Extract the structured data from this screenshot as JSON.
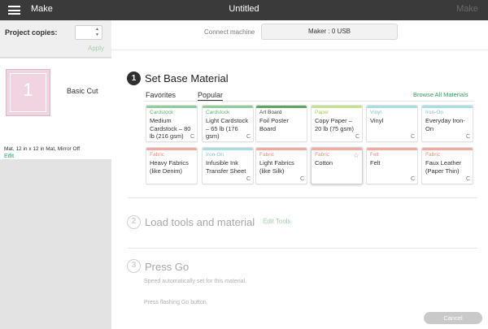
{
  "topbar": {
    "app_name": "Make",
    "title": "Untitled",
    "right_action": "Make",
    "menu_icon": "hamburger-menu-icon"
  },
  "left_panel": {
    "copies_label": "Project copies:",
    "copies_value": "",
    "apply_label": "Apply",
    "mat": {
      "number": "1",
      "cut_label": "Basic Cut",
      "description": "Mat, 12 in x 12 in Mat, Mirror Off",
      "edit_label": "Edit"
    }
  },
  "machine": {
    "label": "Connect machine",
    "value": "Maker : 0 USB"
  },
  "steps": {
    "step1": {
      "number": "1",
      "title": "Set Base Material"
    },
    "step2": {
      "number": "2",
      "title": "Load tools and material",
      "edit_tools": "Edit Tools"
    },
    "step3": {
      "number": "3",
      "title": "Press Go",
      "speed_note": "Speed automatically set for this material.",
      "press_note": "Press flashing Go button."
    }
  },
  "material_tabs": {
    "tabs": [
      "Favorites",
      "Popular"
    ],
    "active": "Popular",
    "browse_all": "Browse All Materials"
  },
  "materials": [
    {
      "category": "Cardstock",
      "name": "Medium Cardstock – 80 lb (216 gsm)",
      "color": "#8fce97",
      "cat_color": "#5fb26a",
      "icon": "C"
    },
    {
      "category": "Cardstock",
      "name": "Light Cardstock – 65 lb (176 gsm)",
      "color": "#8fce97",
      "cat_color": "#5fb26a",
      "icon": "C"
    },
    {
      "category": "Art Board",
      "name": "Foil Poster Board",
      "color": "#5fa463",
      "cat_color": "#444444",
      "icon": ""
    },
    {
      "category": "Paper",
      "name": "Copy Paper – 20 lb (75 gsm)",
      "color": "#c5e38e",
      "cat_color": "#a3cc55",
      "icon": "C"
    },
    {
      "category": "Vinyl",
      "name": "Vinyl",
      "color": "#a9dde3",
      "cat_color": "#7dc7d0",
      "icon": "C"
    },
    {
      "category": "Iron-On",
      "name": "Everyday Iron-On",
      "color": "#a9dde3",
      "cat_color": "#7dc7d0",
      "icon": "C"
    },
    {
      "category": "Fabric",
      "name": "Heavy Fabrics (like Denim)",
      "color": "#f2aba0",
      "cat_color": "#e98a7c",
      "icon": ""
    },
    {
      "category": "Iron-On",
      "name": "Infusible Ink Transfer Sheet",
      "color": "#a9dde3",
      "cat_color": "#7dc7d0",
      "icon": "C"
    },
    {
      "category": "Fabric",
      "name": "Light Fabrics (like Silk)",
      "color": "#f2aba0",
      "cat_color": "#e98a7c",
      "icon": "C"
    },
    {
      "category": "Fabric",
      "name": "Cotton",
      "color": "#f2aba0",
      "cat_color": "#e98a7c",
      "icon": "",
      "selected": true,
      "star": "☆"
    },
    {
      "category": "Felt",
      "name": "Felt",
      "color": "#f2aba0",
      "cat_color": "#e98a7c",
      "icon": "C"
    },
    {
      "category": "Fabric",
      "name": "Faux Leather (Paper Thin)",
      "color": "#f2aba0",
      "cat_color": "#e98a7c",
      "icon": "C"
    }
  ],
  "footer": {
    "cancel_label": "Cancel"
  }
}
